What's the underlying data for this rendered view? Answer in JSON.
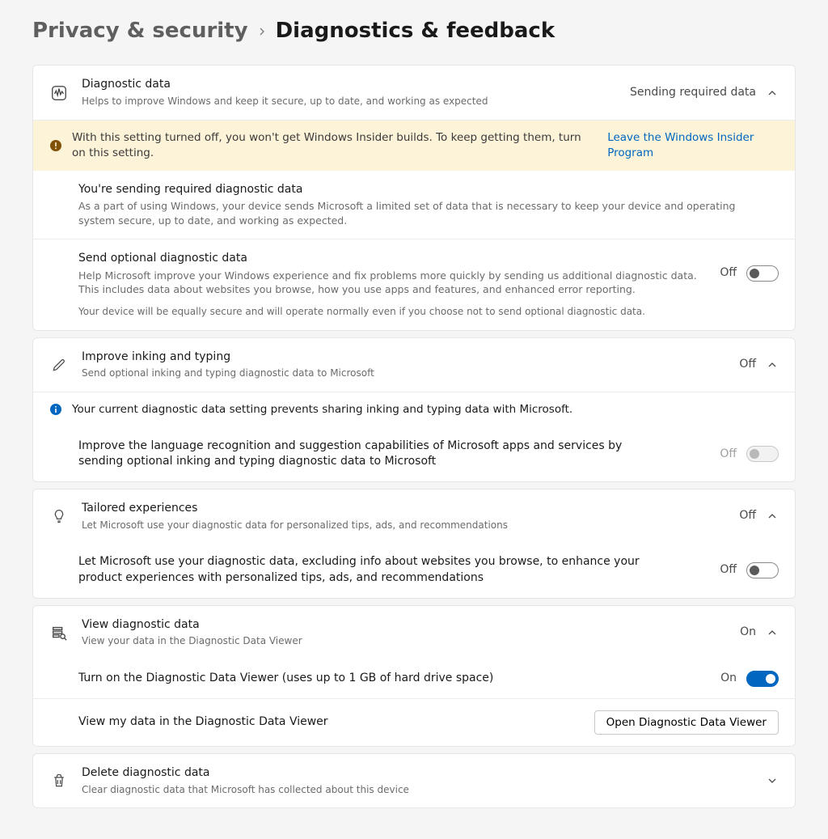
{
  "breadcrumb": {
    "parent": "Privacy & security",
    "current": "Diagnostics & feedback"
  },
  "diagnostic_data": {
    "title": "Diagnostic data",
    "desc": "Helps to improve Windows and keep it secure, up to date, and working as expected",
    "state": "Sending required data",
    "warning": "With this setting turned off, you won't get Windows Insider builds. To keep getting them, turn on this setting.",
    "warning_link": "Leave the Windows Insider Program",
    "required_title": "You're sending required diagnostic data",
    "required_desc": "As a part of using Windows, your device sends Microsoft a limited set of data that is necessary to keep your device and operating system secure, up to date, and working as expected.",
    "optional_title": "Send optional diagnostic data",
    "optional_desc": "Help Microsoft improve your Windows experience and fix problems more quickly by sending us additional diagnostic data. This includes data about websites you browse, how you use apps and features, and enhanced error reporting.",
    "optional_note": "Your device will be equally secure and will operate normally even if you choose not to send optional diagnostic data.",
    "optional_state": "Off"
  },
  "inking": {
    "title": "Improve inking and typing",
    "desc": "Send optional inking and typing diagnostic data to Microsoft",
    "state": "Off",
    "info": "Your current diagnostic data setting prevents sharing inking and typing data with Microsoft.",
    "sub_desc": "Improve the language recognition and suggestion capabilities of Microsoft apps and services by sending optional inking and typing diagnostic data to Microsoft",
    "sub_state": "Off"
  },
  "tailored": {
    "title": "Tailored experiences",
    "desc": "Let Microsoft use your diagnostic data for personalized tips, ads, and recommendations",
    "state": "Off",
    "sub_desc": "Let Microsoft use your diagnostic data, excluding info about websites you browse, to enhance your product experiences with personalized tips, ads, and recommendations",
    "sub_state": "Off"
  },
  "view_data": {
    "title": "View diagnostic data",
    "desc": "View your data in the Diagnostic Data Viewer",
    "state": "On",
    "sub1_desc": "Turn on the Diagnostic Data Viewer (uses up to 1 GB of hard drive space)",
    "sub1_state": "On",
    "sub2_desc": "View my data in the Diagnostic Data Viewer",
    "sub2_button": "Open Diagnostic Data Viewer"
  },
  "delete": {
    "title": "Delete diagnostic data",
    "desc": "Clear diagnostic data that Microsoft has collected about this device"
  }
}
